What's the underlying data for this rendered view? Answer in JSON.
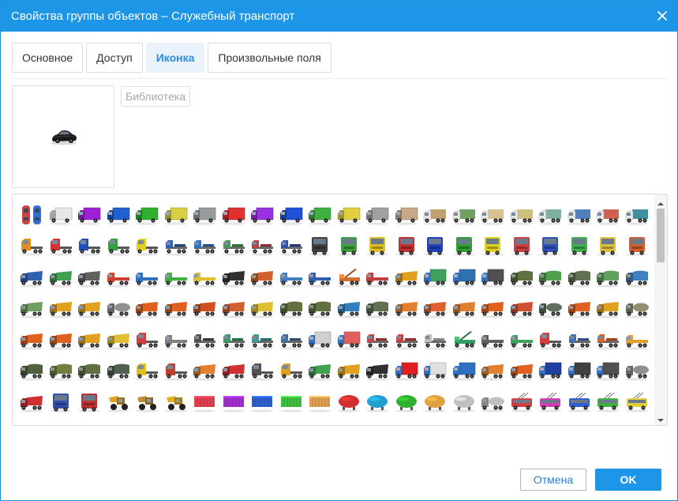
{
  "dialog": {
    "title": "Свойства группы объектов – Служебный транспорт",
    "close_icon": "close-icon"
  },
  "tabs": [
    {
      "label": "Основное",
      "active": false
    },
    {
      "label": "Доступ",
      "active": false
    },
    {
      "label": "Иконка",
      "active": true
    },
    {
      "label": "Произвольные поля",
      "active": false
    }
  ],
  "preview": {
    "icon": "black-car-icon"
  },
  "library_button": {
    "label": "Библиотека"
  },
  "footer": {
    "cancel_label": "Отмена",
    "ok_label": "OK"
  },
  "colors": {
    "accent": "#1e96e8",
    "tab_active_bg": "#eaf3fc",
    "tab_active_text": "#2a8be0",
    "disabled_text": "#a8a8a8"
  },
  "icon_grid": {
    "rows": [
      {
        "kind": "row-1",
        "types": [
          "topcar",
          "van",
          "van",
          "van",
          "van",
          "van",
          "van",
          "van",
          "van",
          "van",
          "van",
          "van",
          "van",
          "van",
          "truck",
          "truck",
          "truck",
          "truck",
          "truck",
          "truck",
          "truck",
          "truck"
        ],
        "colors": [
          "#d04040",
          "#e8e8e8",
          "#9b20d8",
          "#2060d0",
          "#30b030",
          "#d8d040",
          "#9a9a9a",
          "#e03030",
          "#9b30e0",
          "#2050d8",
          "#40b040",
          "#e0d040",
          "#a0a0a0",
          "#c8a888",
          "#c0a070",
          "#70a060",
          "#d8c090",
          "#d0c080",
          "#80b0a0",
          "#5080c0",
          "#d06050",
          "#4090a0"
        ]
      },
      {
        "kind": "row-2",
        "types": [
          "tractor",
          "tractor",
          "tractor",
          "tractor",
          "tractor",
          "semi",
          "semi",
          "semi",
          "semi",
          "semi",
          "cab",
          "cab",
          "cab",
          "cab",
          "cab",
          "cab",
          "cab",
          "cab",
          "cab",
          "cab",
          "cab",
          "cab"
        ],
        "colors": [
          "#e09020",
          "#d83030",
          "#2050c0",
          "#30a040",
          "#e0d020",
          "#3060b0",
          "#3070c0",
          "#40a050",
          "#c04040",
          "#3050b0",
          "#404040",
          "#40a040",
          "#e0c020",
          "#c03030",
          "#2040c0",
          "#30a030",
          "#e0d020",
          "#d04040",
          "#3050c0",
          "#40b050",
          "#e0c040",
          "#d06030"
        ]
      },
      {
        "kind": "row-3",
        "types": [
          "dump",
          "dump",
          "dump",
          "flatbed",
          "flatbed",
          "flatbed",
          "flatbed",
          "dump",
          "dump",
          "flatbed",
          "flatbed",
          "crane",
          "flatbed",
          "dump",
          "box",
          "box",
          "box",
          "military",
          "military",
          "military",
          "military",
          "military"
        ],
        "colors": [
          "#3060b0",
          "#40a050",
          "#606060",
          "#d04030",
          "#3070c0",
          "#40b040",
          "#e0c030",
          "#303030",
          "#d06030",
          "#4080c0",
          "#3060b0",
          "#d07030",
          "#c04040",
          "#e0a020",
          "#40a060",
          "#3070b0",
          "#505050",
          "#607040",
          "#50a050",
          "#607050",
          "#60a060",
          "#4080c0"
        ]
      },
      {
        "kind": "row-4",
        "types": [
          "dump",
          "dump",
          "dump",
          "tank",
          "dump",
          "dump",
          "dump",
          "dump",
          "dump",
          "military",
          "military",
          "dump",
          "military",
          "dump",
          "dump",
          "dump",
          "dump",
          "dump",
          "tank",
          "dump",
          "dump",
          "tank"
        ],
        "colors": [
          "#70a060",
          "#e0a020",
          "#e0a020",
          "#909090",
          "#e06020",
          "#e06020",
          "#d05020",
          "#d06030",
          "#e0c030",
          "#607040",
          "#607040",
          "#3080c0",
          "#607050",
          "#e08030",
          "#e06030",
          "#e08030",
          "#e06020",
          "#d05030",
          "#607060",
          "#e06020",
          "#e0a020",
          "#909070"
        ]
      },
      {
        "kind": "row-5",
        "types": [
          "dump",
          "dump",
          "dump",
          "dump",
          "tractor",
          "flatbed",
          "semi",
          "semi",
          "semi",
          "semi",
          "box",
          "box",
          "semi",
          "semi",
          "semi",
          "crane",
          "flatbed",
          "flatbed",
          "tractor",
          "semi",
          "semi",
          "flatbed"
        ],
        "colors": [
          "#e06020",
          "#e06020",
          "#e0a020",
          "#e0c030",
          "#d04040",
          "#808080",
          "#505050",
          "#30a060",
          "#30a0a0",
          "#4070a0",
          "#d0d0d0",
          "#e06060",
          "#d04040",
          "#d04040",
          "#c0c0c0",
          "#30a060",
          "#606060",
          "#40a060",
          "#d04040",
          "#4070c0",
          "#e06020",
          "#e0a030"
        ]
      },
      {
        "kind": "row-6",
        "types": [
          "military",
          "military",
          "military",
          "military",
          "tractor",
          "tractor",
          "dump",
          "dump",
          "tractor",
          "tractor",
          "dump",
          "dump",
          "dump",
          "box",
          "box",
          "box",
          "dump",
          "dump",
          "box",
          "box",
          "box",
          "tank"
        ],
        "colors": [
          "#506040",
          "#708040",
          "#607040",
          "#506050",
          "#e0c020",
          "#c04030",
          "#e08030",
          "#d03030",
          "#505050",
          "#e0a020",
          "#40a050",
          "#e0a020",
          "#303030",
          "#e02020",
          "#e0e0e0",
          "#3070c0",
          "#e08030",
          "#e06020",
          "#2040a0",
          "#404040",
          "#505050",
          "#909090"
        ]
      },
      {
        "kind": "row-7",
        "types": [
          "dump",
          "cab",
          "cab",
          "loader",
          "loader",
          "loader",
          "container",
          "container",
          "container",
          "container",
          "container",
          "barrel",
          "barrel",
          "barrel",
          "barrel",
          "barrel",
          "tank",
          "trolley",
          "trolley",
          "trolley",
          "trolley",
          "trolley"
        ],
        "colors": [
          "#d03030",
          "#3050b0",
          "#c03030",
          "#e0a020",
          "#c09030",
          "#e0b020",
          "#e04050",
          "#a030d0",
          "#3060d0",
          "#40c040",
          "#e0a050",
          "#d03030",
          "#20a0d0",
          "#30b030",
          "#e0a040",
          "#c0c0c0",
          "#c0c0c0",
          "#d04040",
          "#d040b0",
          "#3060d0",
          "#40b040",
          "#e0d040"
        ]
      },
      {
        "kind": "row-8",
        "types": [
          "bus",
          "bus",
          "bus",
          "bus",
          "bus",
          "bus",
          "bus",
          "bus",
          "bus",
          "bus",
          "bus",
          "bus",
          "bus",
          "bus",
          "bus",
          "bus",
          "bus",
          "bus",
          "car",
          "bus",
          "bus",
          "bus"
        ],
        "colors": [
          "#d04040",
          "#c0c0c0",
          "#e0e0e0",
          "#d04040",
          "#c0c0c0",
          "#d0d0d0",
          "#c08060",
          "#e0e0e0",
          "#d0d0d0",
          "#d06060",
          "#e04040",
          "#a0a0a0",
          "#c0d0e0",
          "#40a040",
          "#c03030",
          "#d04040",
          "#e0e0e0",
          "#e0a030",
          "#303030",
          "#e0b050",
          "#a06060",
          "#4080d0"
        ]
      }
    ]
  }
}
